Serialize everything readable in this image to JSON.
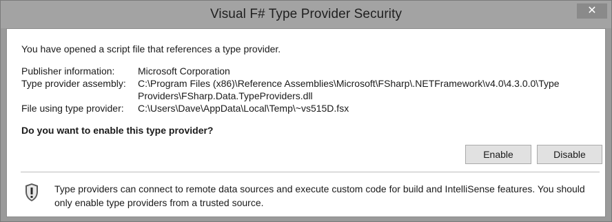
{
  "window": {
    "title": "Visual F# Type Provider Security",
    "close_label": "✕"
  },
  "dialog": {
    "intro": "You have opened a script file that references a type provider.",
    "publisher_label": "Publisher information:",
    "publisher_value": "Microsoft Corporation",
    "assembly_label": "Type provider assembly:",
    "assembly_value": "C:\\Program Files (x86)\\Reference Assemblies\\Microsoft\\FSharp\\.NETFramework\\v4.0\\4.3.0.0\\Type Providers\\FSharp.Data.TypeProviders.dll",
    "file_label": "File using type provider:",
    "file_value": "C:\\Users\\Dave\\AppData\\Local\\Temp\\~vs515D.fsx",
    "question": "Do you want to enable this type provider?",
    "enable_label": "Enable",
    "disable_label": "Disable",
    "warning": "Type providers can connect to remote data sources and execute custom code for build and IntelliSense features.  You should only enable type providers from a trusted source.",
    "warning_icon": "shield-warning-icon"
  }
}
